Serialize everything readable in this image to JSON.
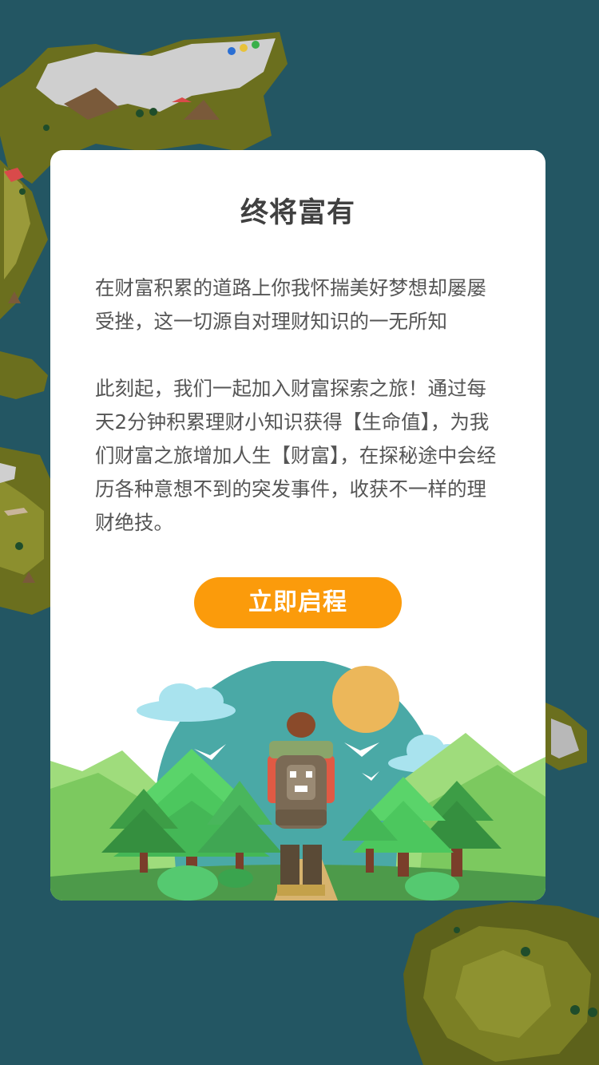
{
  "colors": {
    "background": "#235663",
    "card": "#ffffff",
    "title_text": "#404040",
    "body_text": "#555555",
    "button": "#fb9b0b",
    "button_text": "#ffffff"
  },
  "dialog": {
    "title": "终将富有",
    "paragraph_1": "在财富积累的道路上你我怀揣美好梦想却屡屡受挫，这一切源自对理财知识的一无所知",
    "paragraph_2": "此刻起，我们一起加入财富探索之旅！通过每天2分钟积累理财小知识获得【生命值】，为我们财富之旅增加人生【财富】，在探秘途中会经历各种意想不到的突发事件，收获不一样的理财绝技。",
    "start_button_label": "立即启程"
  },
  "illustration": {
    "subject": "hiker-with-backpack",
    "elements": [
      "sun",
      "clouds",
      "birds",
      "mountains",
      "pine-trees",
      "path"
    ]
  },
  "background_icons": [
    "map-island-top-left",
    "map-island-left",
    "map-island-bottom-right",
    "map-island-right"
  ]
}
